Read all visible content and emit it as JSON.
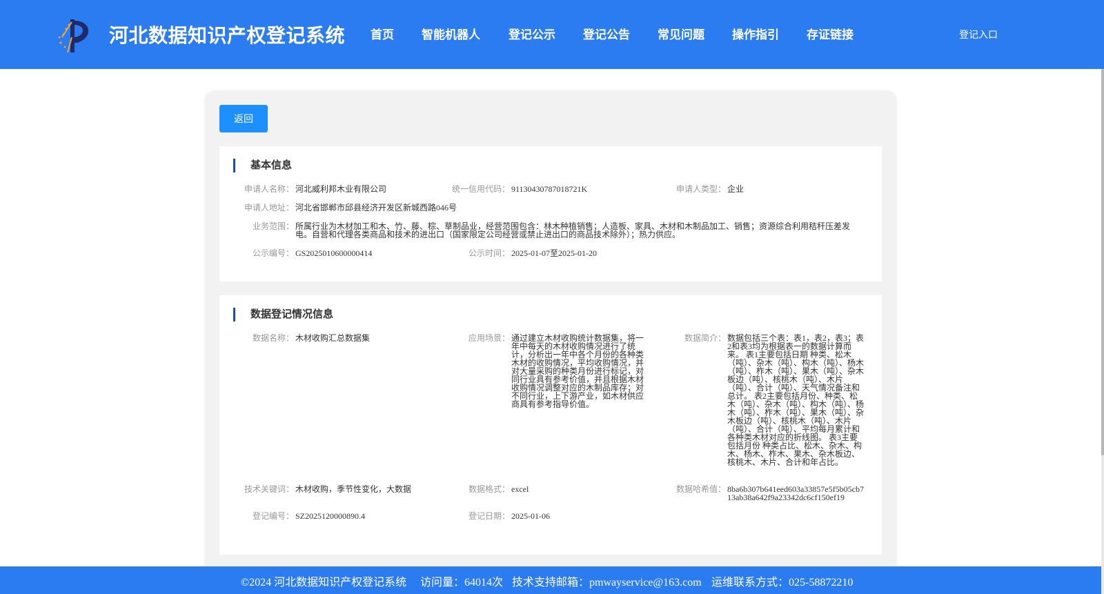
{
  "header": {
    "site_title": "河北数据知识产权登记系统",
    "nav": [
      "首页",
      "智能机器人",
      "登记公示",
      "登记公告",
      "常见问题",
      "操作指引",
      "存证链接"
    ],
    "login_label": "登记入口"
  },
  "back_label": "返回",
  "basic_info": {
    "title": "基本信息",
    "applicant_name": {
      "label": "申请人名称：",
      "value": "河北威利邦木业有限公司"
    },
    "credit_code": {
      "label": "统一信用代码：",
      "value": "91130430787018721K"
    },
    "applicant_type": {
      "label": "申请人类型：",
      "value": "企业"
    },
    "applicant_address": {
      "label": "申请人地址：",
      "value": "河北省邯郸市邱县经济开发区新城西路046号"
    },
    "business_scope": {
      "label": "业务范围：",
      "value": "所属行业为木材加工和木、竹、藤、棕、草制品业，经营范围包含：林木种植销售；人造板、家具、木材和木制品加工、销售；资源综合利用秸秆压差发电。自营和代理各类商品和技术的进出口（国家限定公司经营或禁止进出口的商品技术除外）；热力供应。"
    },
    "publicity_no": {
      "label": "公示编号：",
      "value": "GS2025010600000414"
    },
    "publicity_time": {
      "label": "公示时间：",
      "value": "2025-01-07至2025-01-20"
    }
  },
  "data_info": {
    "title": "数据登记情况信息",
    "data_name": {
      "label": "数据名称：",
      "value": "木材收购汇总数据集"
    },
    "scenario": {
      "label": "应用场景：",
      "value": "通过建立木材收购统计数据集，将一年中每天的木材收购情况进行了统计，分析出一年中各个月份的各种类木材的收购情况，平均收购情况，并对大量采购的种类月份进行标记，对同行业具有参考价值，并且根据木材收购情况调整对应的木制品库存；对不同行业，上下游产业，如木材供应商具有参考指导价值。"
    },
    "summary": {
      "label": "数据简介：",
      "value": "数据包括三个表：表1，表2，表3；表2和表3均为根据表一的数据计算而来。 表1主要包括日期 种类、松木（吨）、杂木（吨）、构木（吨）、杨木（吨）、柞木（吨）、果木（吨）、杂木板边（吨）、核桃木（吨）、木片（吨）、合计（吨）、天气情况备注和总计。 表2主要包括月份、种类、松木（吨）、杂木（吨）、构木（吨）、杨木（吨）、柞木（吨）、果木（吨）、杂木板边（吨）、核桃木（吨）、木片（吨）、合计（吨）、平均每月累计和各种类木材对应的折线图。 表3主要包括月份 种类占比、松木、杂木、构木、杨木、柞木、果木、杂木板边、核桃木、木片、合计和年占比。"
    },
    "keywords": {
      "label": "技术关键词：",
      "value": "木材收购，季节性变化，大数据"
    },
    "format": {
      "label": "数据格式：",
      "value": "excel"
    },
    "hash": {
      "label": "数据哈希值：",
      "value": "8ba6b307b641eed603a33857e5f5b05cb713ab38a642f9a23342dc6cf150ef19"
    },
    "reg_no": {
      "label": "登记编号：",
      "value": "SZ2025120000890.4"
    },
    "reg_date": {
      "label": "登记日期：",
      "value": "2025-01-06"
    }
  },
  "footer": {
    "copyright": "©2024 河北数据知识产权登记系统",
    "visits": "访问量：64014次",
    "email": "技术支持邮箱：pmwayservice@163.com",
    "phone": "运维联系方式：025-58872210"
  },
  "colors": {
    "primary": "#2b7cf0",
    "button": "#1e8fff",
    "accent_bar": "#1a4fa0"
  }
}
